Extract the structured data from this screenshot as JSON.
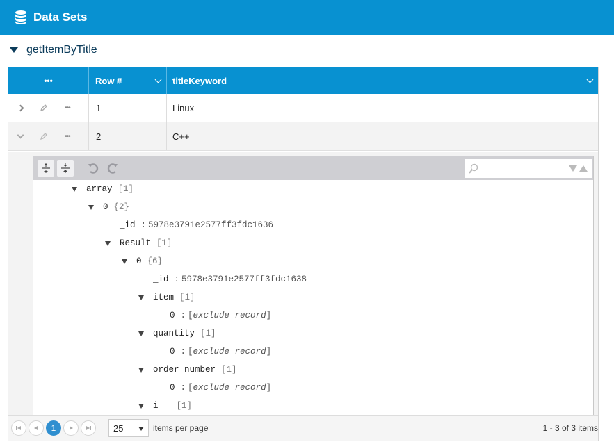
{
  "app": {
    "title": "Data Sets",
    "accent": "#0891d1"
  },
  "dataset": {
    "name": "getItemByTitle"
  },
  "grid": {
    "columns": [
      {
        "label": "•••"
      },
      {
        "label": "Row #"
      },
      {
        "label": "titleKeyword"
      }
    ],
    "rows": [
      {
        "row_num": "1",
        "title": "Linux",
        "expanded": false
      },
      {
        "row_num": "2",
        "title": "C++",
        "expanded": true
      }
    ]
  },
  "editor": {
    "toolbar": {
      "icons": [
        "expand-all-icon",
        "collapse-all-icon",
        "undo-icon",
        "redo-icon"
      ],
      "search_placeholder": ""
    },
    "tree": [
      {
        "key": "array",
        "count": "[1]",
        "collapsible": true
      },
      {
        "key": "0",
        "count": "{2}",
        "collapsible": true
      },
      {
        "key": "_id",
        "sep": ":",
        "value": "5978e3791e2577ff3fdc1636"
      },
      {
        "key": "Result",
        "count": "[1]",
        "collapsible": true
      },
      {
        "key": "0",
        "count": "{6}",
        "collapsible": true
      },
      {
        "key": "_id",
        "sep": ":",
        "value": "5978e3791e2577ff3fdc1638"
      },
      {
        "key": "item",
        "count": "[1]",
        "collapsible": true
      },
      {
        "key": "0",
        "sep": ":",
        "value_prefix": "[",
        "value_italic": "exclude record",
        "value_suffix": "]"
      },
      {
        "key": "quantity",
        "count": "[1]",
        "collapsible": true
      },
      {
        "key": "0",
        "sep": ":",
        "value_prefix": "[",
        "value_italic": "exclude record",
        "value_suffix": "]"
      },
      {
        "key": "order_number",
        "count": "[1]",
        "collapsible": true
      },
      {
        "key": "0",
        "sep": ":",
        "value_prefix": "[",
        "value_italic": "exclude record",
        "value_suffix": "]"
      },
      {
        "key": "i",
        "count": "[1]",
        "collapsible": true
      }
    ]
  },
  "pager": {
    "current_page": "1",
    "page_size": "25",
    "per_page_label": "items per page",
    "range_label": "1 - 3 of 3 items"
  }
}
